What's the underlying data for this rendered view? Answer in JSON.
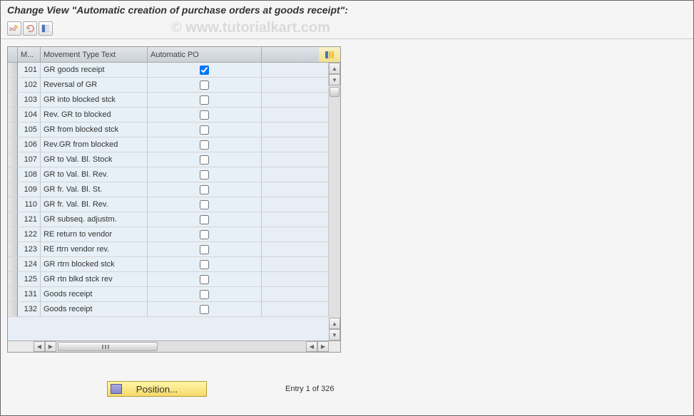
{
  "header": {
    "title": "Change View \"Automatic creation of purchase orders at goods receipt\":"
  },
  "watermark": "© www.tutorialkart.com",
  "columns": {
    "mv": "M...",
    "txt": "Movement Type Text",
    "apo": "Automatic PO"
  },
  "rows": [
    {
      "mv": "101",
      "txt": "GR goods receipt",
      "apo": true
    },
    {
      "mv": "102",
      "txt": "Reversal of GR",
      "apo": false
    },
    {
      "mv": "103",
      "txt": "GR into blocked stck",
      "apo": false
    },
    {
      "mv": "104",
      "txt": "Rev. GR to blocked",
      "apo": false
    },
    {
      "mv": "105",
      "txt": "GR from blocked stck",
      "apo": false
    },
    {
      "mv": "106",
      "txt": "Rev.GR from blocked",
      "apo": false
    },
    {
      "mv": "107",
      "txt": "GR to Val. Bl. Stock",
      "apo": false
    },
    {
      "mv": "108",
      "txt": "GR to Val. Bl. Rev.",
      "apo": false
    },
    {
      "mv": "109",
      "txt": "GR fr. Val. Bl. St.",
      "apo": false
    },
    {
      "mv": "110",
      "txt": "GR fr. Val. Bl. Rev.",
      "apo": false
    },
    {
      "mv": "121",
      "txt": "GR subseq. adjustm.",
      "apo": false
    },
    {
      "mv": "122",
      "txt": "RE return to vendor",
      "apo": false
    },
    {
      "mv": "123",
      "txt": "RE rtrn vendor rev.",
      "apo": false
    },
    {
      "mv": "124",
      "txt": "GR rtrn blocked stck",
      "apo": false
    },
    {
      "mv": "125",
      "txt": "GR rtn blkd stck rev",
      "apo": false
    },
    {
      "mv": "131",
      "txt": "Goods receipt",
      "apo": false
    },
    {
      "mv": "132",
      "txt": "Goods receipt",
      "apo": false
    }
  ],
  "footer": {
    "position_btn": "Position...",
    "entry_text": "Entry 1 of 326"
  },
  "icons": {
    "toggle": "display-change",
    "undo": "undo",
    "select": "select-block"
  }
}
